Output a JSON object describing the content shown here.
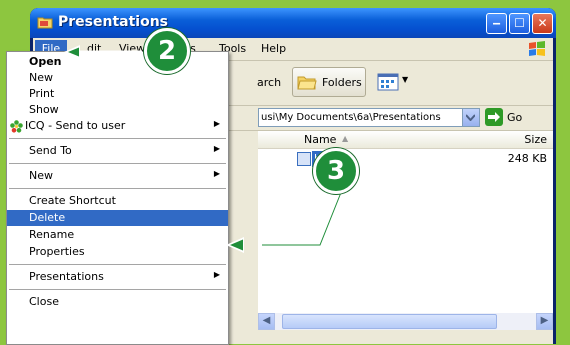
{
  "window": {
    "title": "Presentations",
    "buttons": {
      "minimize": "‒",
      "maximize": "☐",
      "close": "✕"
    }
  },
  "menubar": {
    "items": [
      "File",
      "Edit",
      "View",
      "Favorites",
      "Tools",
      "Help"
    ],
    "visible_fragments": {
      "edit": "dit",
      "view": "View",
      "favorites": "tes",
      "tools": "Tools",
      "help": "Help"
    }
  },
  "toolbar": {
    "search_fragment": "arch",
    "folders_label": "Folders"
  },
  "address": {
    "path": "usi\\My Documents\\6a\\Presentations",
    "go_label": "Go"
  },
  "file_list": {
    "headers": {
      "name": "Name",
      "size": "Size"
    },
    "files": [
      {
        "name": "healt",
        "size": "248 KB"
      }
    ]
  },
  "file_menu": {
    "items": [
      {
        "label": "Open",
        "bold": true
      },
      {
        "label": "New"
      },
      {
        "label": "Print"
      },
      {
        "label": "Show"
      },
      {
        "label": "ICQ - Send to user",
        "submenu": true
      },
      {
        "label": "Send To",
        "submenu": true
      },
      {
        "label": "New",
        "submenu": true
      },
      {
        "label": "Create Shortcut"
      },
      {
        "label": "Delete",
        "highlighted": true
      },
      {
        "label": "Rename"
      },
      {
        "label": "Properties"
      },
      {
        "label": "Presentations",
        "submenu": true
      },
      {
        "label": "Close"
      }
    ]
  },
  "callouts": [
    {
      "number": "2"
    },
    {
      "number": "3"
    }
  ],
  "colors": {
    "background": "#8dc63f",
    "badge": "#1f8e3a",
    "highlight": "#316ac5",
    "titlebar": "#0a5fd8"
  }
}
